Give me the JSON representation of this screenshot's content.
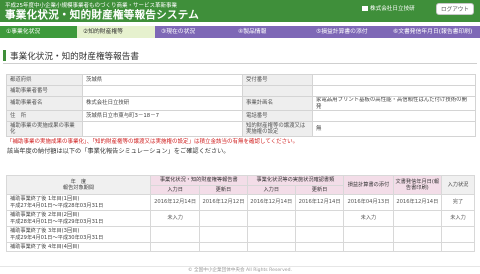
{
  "header": {
    "sub_title": "平成25年度中小企業小規模事業者ものづくり商業・サービス革新事業",
    "title": "事業化状況・知的財産権等報告システム",
    "company": "株式会社日立技研",
    "logout_label": "ログアウト"
  },
  "steps": [
    {
      "label": "①事業化状況"
    },
    {
      "label": "②知的財産権等"
    },
    {
      "label": "③現在の状況"
    },
    {
      "label": "④製品情報"
    },
    {
      "label": "⑤損益計算書の添付"
    },
    {
      "label": "⑥文書発信年月日(報告書印刷)"
    }
  ],
  "page_title": "事業化状況・知的財産権等報告書",
  "info": {
    "prefecture_label": "都道府県",
    "prefecture_value": "茨城県",
    "receipt_no_label": "受付番号",
    "receipt_no_value": "",
    "subsidy_no_label": "補助事業者番号",
    "subsidy_no_value": "",
    "company_name_label": "補助事業者名",
    "company_name_value": "株式会社日立技研",
    "project_name_label": "事業計画名",
    "project_name_value": "家電品用プリント基板の高性能・高信頼性はんだ付け技術の開発",
    "address_label": "住　所",
    "address_value": "茨城県日立市東与町3－18－7",
    "phone_label": "電話番号",
    "phone_value": "",
    "implementation_label": "補助事業の実施成果の事業化",
    "implementation_value": "",
    "ip_label": "知的財産権等の譲渡又は実施権の設定",
    "ip_value": "無"
  },
  "warning": "「補助事業の実施成果の事業化」、「知的財産権等の譲渡又は実施権の設定」は積立金該当の有無を確認してください。",
  "note": "該当年度の納付額は以下の「事業化報告シミュレーション」をご確認ください。",
  "status_table": {
    "col_year": "年　度",
    "col_year_sub": "報告対象期間",
    "group1": "事業化状況・知的財産権等報告書",
    "group2": "事業化状況等の実施状況確認書類",
    "col_pl": "損益計算書の添付",
    "col_doc_date": "文書発信年月日(報告書印刷)",
    "col_input": "入力状況",
    "sub_input_date": "入力日",
    "sub_update_date": "更新日",
    "rows": [
      {
        "label": "補助事業終了後 1年目(1回目)",
        "period": "平成27年4月01日〜平成28年03月31日",
        "c1": "2016年12月14日",
        "c2": "2016年12月12日",
        "c3": "2016年12月14日",
        "c4": "2016年12月14日",
        "c5": "2016年04月13日",
        "c6": "2016年12月14日",
        "c7": "完了"
      },
      {
        "label": "補助事業終了後 2年目(2回目)",
        "period": "平成28年4月01日〜平成29年03月31日",
        "c1": "未入力",
        "c2": "",
        "c3": "",
        "c4": "",
        "c5": "未入力",
        "c6": "",
        "c7": "未入力"
      },
      {
        "label": "補助事業終了後 3年目(3回目)",
        "period": "平成29年4月01日〜平成30年03月31日",
        "c1": "",
        "c2": "",
        "c3": "",
        "c4": "",
        "c5": "",
        "c6": "",
        "c7": ""
      },
      {
        "label": "補助事業終了後 4年目(4回目)",
        "period": "",
        "c1": "",
        "c2": "",
        "c3": "",
        "c4": "",
        "c5": "",
        "c6": "",
        "c7": ""
      }
    ]
  },
  "footer": "© 全国中小企業団体中央会 All Rights Reserved."
}
